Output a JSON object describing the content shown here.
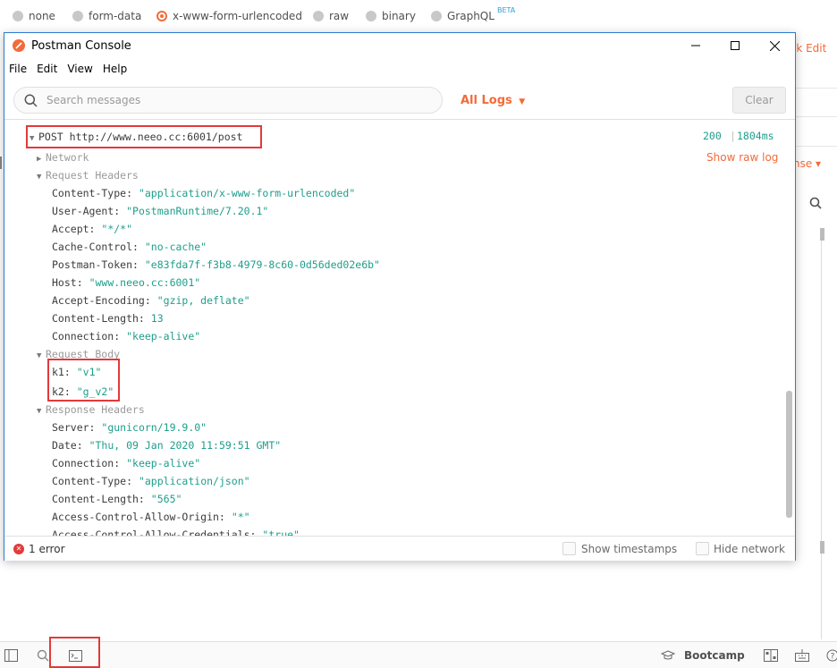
{
  "body_type_options": [
    {
      "label": "none",
      "selected": false
    },
    {
      "label": "form-data",
      "selected": false
    },
    {
      "label": "x-www-form-urlencoded",
      "selected": true
    },
    {
      "label": "raw",
      "selected": false
    },
    {
      "label": "binary",
      "selected": false
    },
    {
      "label": "GraphQL",
      "selected": false,
      "badge": "BETA"
    }
  ],
  "background": {
    "bulk_edit_partial": "lk Edit",
    "response_partial": "nse ▾"
  },
  "console": {
    "title": "Postman Console",
    "menu": [
      "File",
      "Edit",
      "View",
      "Help"
    ],
    "search_placeholder": "Search messages",
    "logs_filter": "All Logs",
    "clear_label": "Clear",
    "request": {
      "line": "POST http://www.neeo.cc:6001/post",
      "status_code": "200",
      "separator": "|",
      "duration": "1804ms",
      "show_raw_log": "Show raw log"
    },
    "sections": {
      "network": "Network",
      "request_headers": "Request Headers",
      "request_body": "Request Body",
      "response_headers": "Response Headers"
    },
    "request_headers": [
      {
        "key": "Content-Type:",
        "value": "\"application/x-www-form-urlencoded\""
      },
      {
        "key": "User-Agent:",
        "value": "\"PostmanRuntime/7.20.1\""
      },
      {
        "key": "Accept:",
        "value": "\"*/*\""
      },
      {
        "key": "Cache-Control:",
        "value": "\"no-cache\""
      },
      {
        "key": "Postman-Token:",
        "value": "\"e83fda7f-f3b8-4979-8c60-0d56ded02e6b\""
      },
      {
        "key": "Host:",
        "value": "\"www.neeo.cc:6001\""
      },
      {
        "key": "Accept-Encoding:",
        "value": "\"gzip, deflate\""
      },
      {
        "key": "Content-Length:",
        "value": "13"
      },
      {
        "key": "Connection:",
        "value": "\"keep-alive\""
      }
    ],
    "request_body": [
      {
        "key": "k1:",
        "value": "\"v1\""
      },
      {
        "key": "k2:",
        "value": "\"g_v2\""
      }
    ],
    "response_headers": [
      {
        "key": "Server:",
        "value": "\"gunicorn/19.9.0\""
      },
      {
        "key": "Date:",
        "value": "\"Thu, 09 Jan 2020 11:59:51 GMT\""
      },
      {
        "key": "Connection:",
        "value": "\"keep-alive\""
      },
      {
        "key": "Content-Type:",
        "value": "\"application/json\""
      },
      {
        "key": "Content-Length:",
        "value": "\"565\""
      },
      {
        "key": "Access-Control-Allow-Origin:",
        "value": "\"*\""
      },
      {
        "key": "Access-Control-Allow-Credentials:",
        "value": "\"true\""
      }
    ],
    "footer": {
      "errors": "1 error",
      "show_timestamps": "Show timestamps",
      "hide_network": "Hide network"
    }
  },
  "statusbar": {
    "bootcamp": "Bootcamp"
  },
  "colors": {
    "accent": "#f26b3a",
    "value": "#1e9e8b",
    "highlight_box": "#e23a3a",
    "window_border": "#2b7bd4"
  }
}
